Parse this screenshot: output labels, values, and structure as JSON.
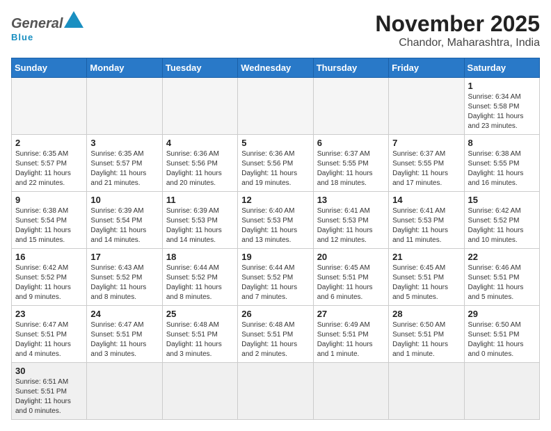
{
  "header": {
    "logo_general": "General",
    "logo_blue": "Blue",
    "month_title": "November 2025",
    "location": "Chandor, Maharashtra, India"
  },
  "weekdays": [
    "Sunday",
    "Monday",
    "Tuesday",
    "Wednesday",
    "Thursday",
    "Friday",
    "Saturday"
  ],
  "days": {
    "d1": {
      "num": "1",
      "info": "Sunrise: 6:34 AM\nSunset: 5:58 PM\nDaylight: 11 hours\nand 23 minutes."
    },
    "d2": {
      "num": "2",
      "info": "Sunrise: 6:35 AM\nSunset: 5:57 PM\nDaylight: 11 hours\nand 22 minutes."
    },
    "d3": {
      "num": "3",
      "info": "Sunrise: 6:35 AM\nSunset: 5:57 PM\nDaylight: 11 hours\nand 21 minutes."
    },
    "d4": {
      "num": "4",
      "info": "Sunrise: 6:36 AM\nSunset: 5:56 PM\nDaylight: 11 hours\nand 20 minutes."
    },
    "d5": {
      "num": "5",
      "info": "Sunrise: 6:36 AM\nSunset: 5:56 PM\nDaylight: 11 hours\nand 19 minutes."
    },
    "d6": {
      "num": "6",
      "info": "Sunrise: 6:37 AM\nSunset: 5:55 PM\nDaylight: 11 hours\nand 18 minutes."
    },
    "d7": {
      "num": "7",
      "info": "Sunrise: 6:37 AM\nSunset: 5:55 PM\nDaylight: 11 hours\nand 17 minutes."
    },
    "d8": {
      "num": "8",
      "info": "Sunrise: 6:38 AM\nSunset: 5:55 PM\nDaylight: 11 hours\nand 16 minutes."
    },
    "d9": {
      "num": "9",
      "info": "Sunrise: 6:38 AM\nSunset: 5:54 PM\nDaylight: 11 hours\nand 15 minutes."
    },
    "d10": {
      "num": "10",
      "info": "Sunrise: 6:39 AM\nSunset: 5:54 PM\nDaylight: 11 hours\nand 14 minutes."
    },
    "d11": {
      "num": "11",
      "info": "Sunrise: 6:39 AM\nSunset: 5:53 PM\nDaylight: 11 hours\nand 14 minutes."
    },
    "d12": {
      "num": "12",
      "info": "Sunrise: 6:40 AM\nSunset: 5:53 PM\nDaylight: 11 hours\nand 13 minutes."
    },
    "d13": {
      "num": "13",
      "info": "Sunrise: 6:41 AM\nSunset: 5:53 PM\nDaylight: 11 hours\nand 12 minutes."
    },
    "d14": {
      "num": "14",
      "info": "Sunrise: 6:41 AM\nSunset: 5:53 PM\nDaylight: 11 hours\nand 11 minutes."
    },
    "d15": {
      "num": "15",
      "info": "Sunrise: 6:42 AM\nSunset: 5:52 PM\nDaylight: 11 hours\nand 10 minutes."
    },
    "d16": {
      "num": "16",
      "info": "Sunrise: 6:42 AM\nSunset: 5:52 PM\nDaylight: 11 hours\nand 9 minutes."
    },
    "d17": {
      "num": "17",
      "info": "Sunrise: 6:43 AM\nSunset: 5:52 PM\nDaylight: 11 hours\nand 8 minutes."
    },
    "d18": {
      "num": "18",
      "info": "Sunrise: 6:44 AM\nSunset: 5:52 PM\nDaylight: 11 hours\nand 8 minutes."
    },
    "d19": {
      "num": "19",
      "info": "Sunrise: 6:44 AM\nSunset: 5:52 PM\nDaylight: 11 hours\nand 7 minutes."
    },
    "d20": {
      "num": "20",
      "info": "Sunrise: 6:45 AM\nSunset: 5:51 PM\nDaylight: 11 hours\nand 6 minutes."
    },
    "d21": {
      "num": "21",
      "info": "Sunrise: 6:45 AM\nSunset: 5:51 PM\nDaylight: 11 hours\nand 5 minutes."
    },
    "d22": {
      "num": "22",
      "info": "Sunrise: 6:46 AM\nSunset: 5:51 PM\nDaylight: 11 hours\nand 5 minutes."
    },
    "d23": {
      "num": "23",
      "info": "Sunrise: 6:47 AM\nSunset: 5:51 PM\nDaylight: 11 hours\nand 4 minutes."
    },
    "d24": {
      "num": "24",
      "info": "Sunrise: 6:47 AM\nSunset: 5:51 PM\nDaylight: 11 hours\nand 3 minutes."
    },
    "d25": {
      "num": "25",
      "info": "Sunrise: 6:48 AM\nSunset: 5:51 PM\nDaylight: 11 hours\nand 3 minutes."
    },
    "d26": {
      "num": "26",
      "info": "Sunrise: 6:48 AM\nSunset: 5:51 PM\nDaylight: 11 hours\nand 2 minutes."
    },
    "d27": {
      "num": "27",
      "info": "Sunrise: 6:49 AM\nSunset: 5:51 PM\nDaylight: 11 hours\nand 1 minute."
    },
    "d28": {
      "num": "28",
      "info": "Sunrise: 6:50 AM\nSunset: 5:51 PM\nDaylight: 11 hours\nand 1 minute."
    },
    "d29": {
      "num": "29",
      "info": "Sunrise: 6:50 AM\nSunset: 5:51 PM\nDaylight: 11 hours\nand 0 minutes."
    },
    "d30": {
      "num": "30",
      "info": "Sunrise: 6:51 AM\nSunset: 5:51 PM\nDaylight: 11 hours\nand 0 minutes."
    }
  }
}
